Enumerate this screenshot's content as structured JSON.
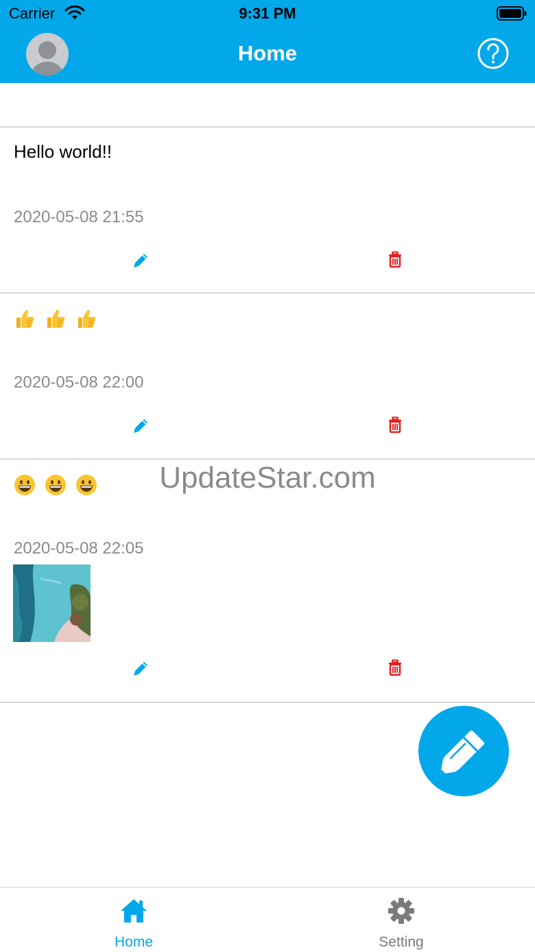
{
  "status_bar": {
    "carrier": "Carrier",
    "time": "9:31 PM",
    "icons": [
      "wifi-icon",
      "battery-icon"
    ]
  },
  "nav": {
    "title": "Home",
    "left_icon": "avatar",
    "right_icon": "help-circle-icon"
  },
  "posts": [
    {
      "text": "Hello world!!",
      "timestamp": "2020-05-08 21:55",
      "has_image": false
    },
    {
      "text": "",
      "emojis": [
        "thumbs-up",
        "thumbs-up",
        "thumbs-up"
      ],
      "timestamp": "2020-05-08 22:00",
      "has_image": false
    },
    {
      "text": "",
      "emojis": [
        "grinning-face",
        "grinning-face",
        "grinning-face"
      ],
      "timestamp": "2020-05-08 22:05",
      "has_image": true,
      "image_description": "aerial beach photo thumbnail"
    }
  ],
  "watermark": "UpdateStar.com",
  "fab": {
    "icon": "pencil-icon"
  },
  "tabs": [
    {
      "label": "Home",
      "icon": "home-icon",
      "active": true
    },
    {
      "label": "Setting",
      "icon": "gear-icon",
      "active": false
    }
  ],
  "colors": {
    "primary": "#02a8ea",
    "delete": "#e02020",
    "timestamp": "#8a8a8a",
    "inactive_tab": "#7b7b7b"
  }
}
